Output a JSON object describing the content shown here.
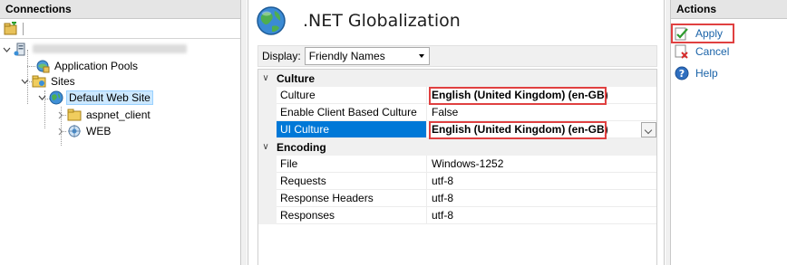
{
  "connections": {
    "title": "Connections",
    "tree": {
      "server": "",
      "app_pools": "Application Pools",
      "sites": "Sites",
      "default_site": "Default Web Site",
      "aspnet_client": "aspnet_client",
      "web": "WEB"
    }
  },
  "feature": {
    "title": ".NET Globalization",
    "display_label": "Display:",
    "display_value": "Friendly Names"
  },
  "grid": {
    "categories": [
      {
        "name": "Culture",
        "rows": [
          {
            "name": "Culture",
            "value": "English (United Kingdom) (en-GB)"
          },
          {
            "name": "Enable Client Based Culture",
            "value": "False"
          },
          {
            "name": "UI Culture",
            "value": "English (United Kingdom) (en-GB)"
          }
        ]
      },
      {
        "name": "Encoding",
        "rows": [
          {
            "name": "File",
            "value": "Windows-1252"
          },
          {
            "name": "Requests",
            "value": "utf-8"
          },
          {
            "name": "Response Headers",
            "value": "utf-8"
          },
          {
            "name": "Responses",
            "value": "utf-8"
          }
        ]
      }
    ]
  },
  "actions": {
    "title": "Actions",
    "apply": "Apply",
    "cancel": "Cancel",
    "help": "Help"
  },
  "colors": {
    "selection": "#0078d7",
    "highlight_box": "#e04040",
    "link": "#1a63a8"
  }
}
